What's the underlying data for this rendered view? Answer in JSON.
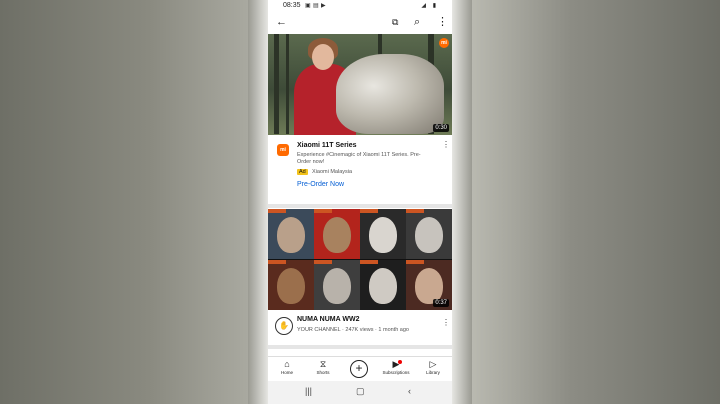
{
  "status_bar": {
    "time": "08:35"
  },
  "ad": {
    "advertiser_logo": "mi",
    "title": "Xiaomi 11T Series",
    "description": "Experience #Cinemagic of Xiaomi 11T Series. Pre-Order now!",
    "ad_tag": "Ad",
    "advertiser": "Xiaomi Malaysia",
    "cta": "Pre-Order Now",
    "thumbnail_duration": "0:30",
    "thumbnail_badge": "mi"
  },
  "video": {
    "title": "NUMA NUMA WW2",
    "meta": "YOUR CHANNEL · 247K views · 1 month ago",
    "duration": "0:37"
  },
  "bottom_nav": {
    "items": [
      {
        "label": "Home",
        "icon": "home-icon"
      },
      {
        "label": "Shorts",
        "icon": "shorts-icon"
      },
      {
        "label": "Subscriptions",
        "icon": "subscriptions-icon"
      },
      {
        "label": "Library",
        "icon": "library-icon"
      }
    ]
  },
  "colors": {
    "accent": "#065fd4",
    "brand": "#ff6a00",
    "ad_tag": "#f2c21b"
  }
}
